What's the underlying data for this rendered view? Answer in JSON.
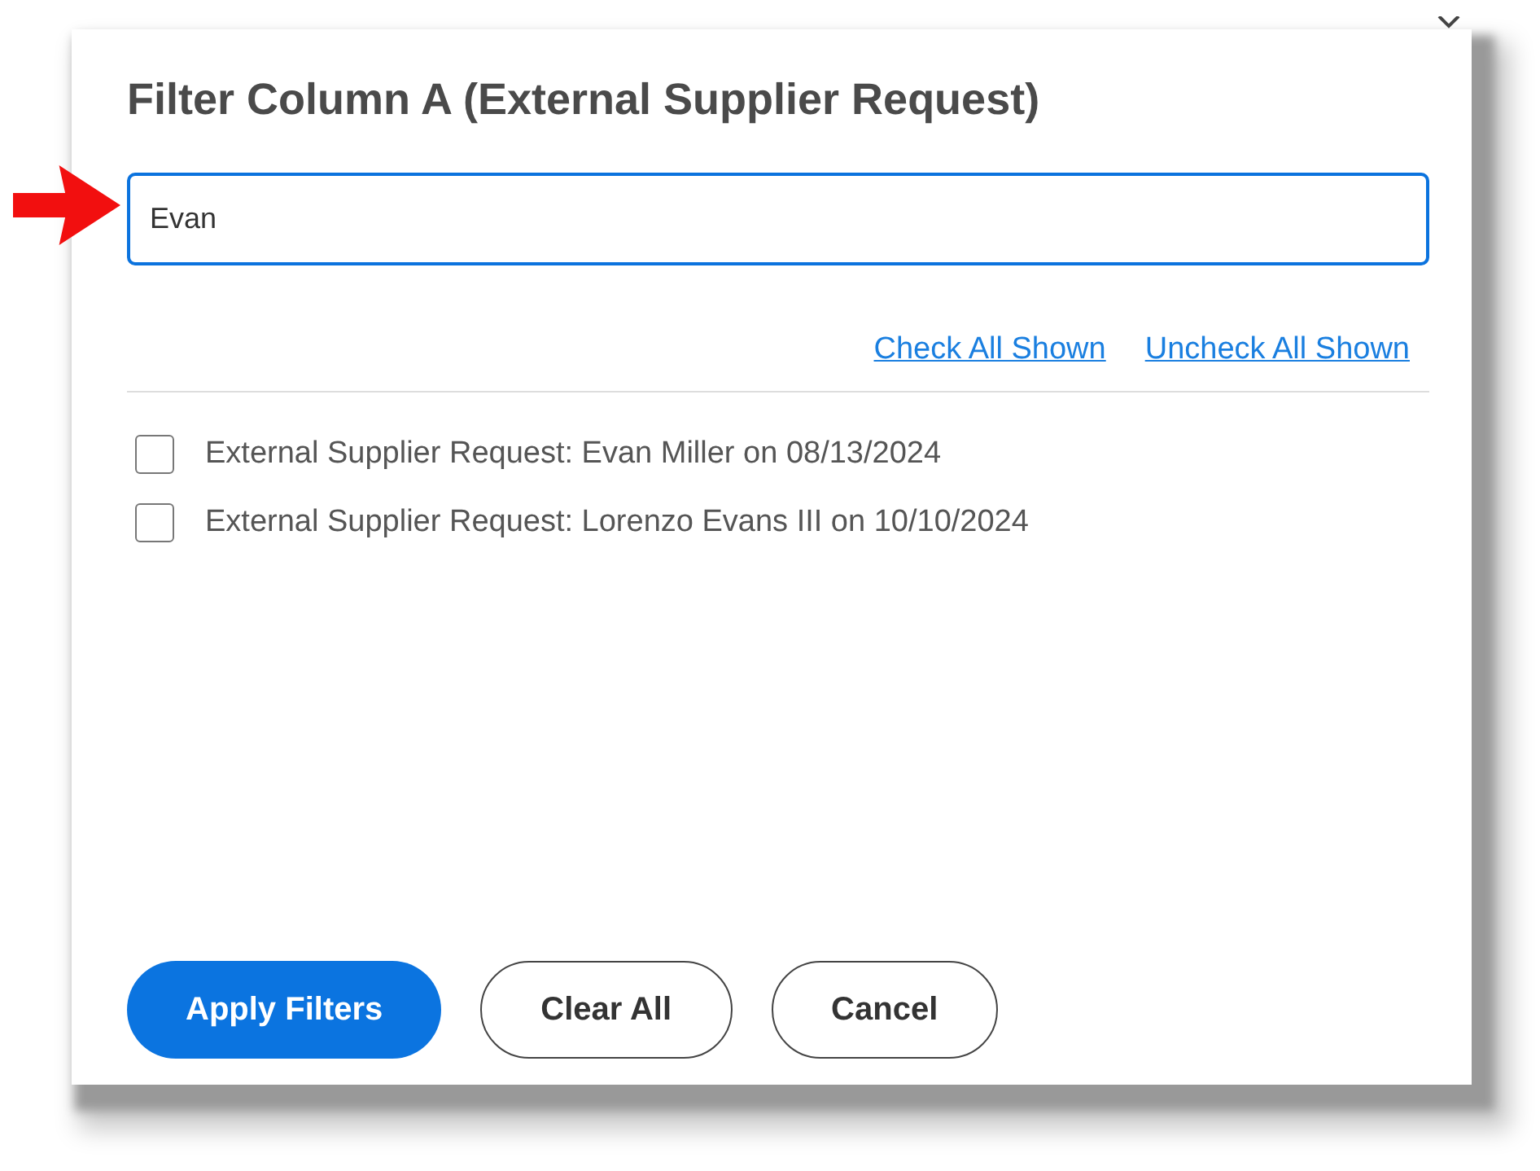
{
  "dialog": {
    "title": "Filter Column A (External Supplier Request)",
    "search": {
      "value": "Evan"
    },
    "links": [
      "Check All Shown",
      "Uncheck All Shown"
    ],
    "options": [
      {
        "label": "External Supplier Request: Evan Miller on 08/13/2024",
        "checked": false
      },
      {
        "label": "External Supplier Request: Lorenzo Evans III on 10/10/2024",
        "checked": false
      }
    ],
    "buttons": [
      {
        "label": "Apply Filters",
        "kind": "primary"
      },
      {
        "label": "Clear All",
        "kind": "outline"
      },
      {
        "label": "Cancel",
        "kind": "outline"
      }
    ]
  }
}
